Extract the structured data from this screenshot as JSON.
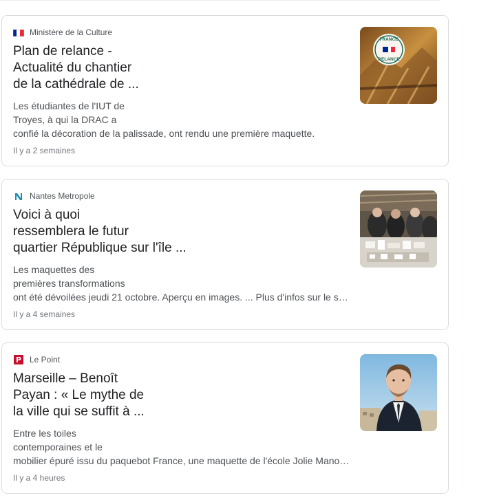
{
  "articles": [
    {
      "source": "Ministère de la Culture",
      "favicon": "french-flag-icon",
      "title_lines": [
        "Plan de relance -",
        "Actualité du chantier",
        "de la cathédrale de ..."
      ],
      "snippet_lines": [
        "Les étudiantes de l'IUT de",
        "Troyes, à qui la DRAC a",
        "confié la décoration de la palissade, ont rendu une première maquette."
      ],
      "time": "Il y a 2 semaines",
      "thumbnail": {
        "badge_text": [
          "FRANCE",
          "RELANCE"
        ]
      }
    },
    {
      "source": "Nantes Metropole",
      "favicon": "nantes-n-icon",
      "title_lines": [
        "Voici à quoi",
        "ressemblera le futur",
        "quartier République sur l'île ..."
      ],
      "snippet_lines": [
        "Les maquettes des",
        "premières transformations",
        "ont été dévoilées jeudi 21 octobre. Aperçu en images. ... Plus d'infos sur le s…"
      ],
      "time": "Il y a 4 semaines"
    },
    {
      "source": "Le Point",
      "favicon": "le-point-p-icon",
      "title_lines": [
        "Marseille – Benoît",
        "Payan : « Le mythe de",
        "la ville qui se suffit à ..."
      ],
      "snippet_lines": [
        "Entre les toiles",
        "contemporaines et le",
        "mobilier épuré issu du paquebot France, une maquette de l'école Jolie Mano…"
      ],
      "time": "Il y a 4 heures"
    }
  ],
  "colors": {
    "title": "#202124",
    "snippet": "#4d5156",
    "time": "#70757a",
    "le_point": "#c8102e",
    "nantes": "#1a8fb0"
  }
}
